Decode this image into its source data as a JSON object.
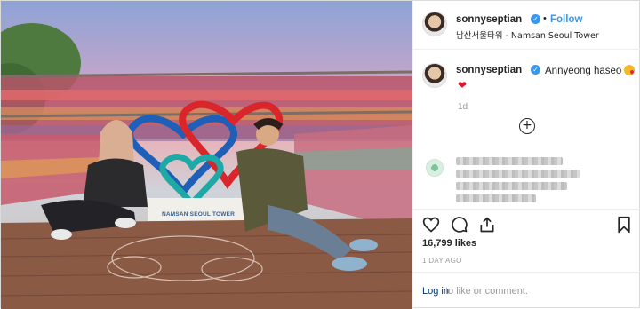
{
  "header": {
    "username": "sonnyseptian",
    "follow_label": "Follow",
    "separator": "•",
    "location": "남산서울타워 - Namsan Seoul Tower"
  },
  "photo": {
    "sign_text": "NAMSAN SEOUL TOWER"
  },
  "caption": {
    "username": "sonnyseptian",
    "text": "Annyeong haseo",
    "heart": "❤",
    "age": "1d"
  },
  "actions": {
    "likes": "16,799 likes",
    "date": "1 DAY AGO"
  },
  "login": {
    "link_label": "Log in",
    "rest_text": "to like or comment."
  },
  "icons": {
    "verified": "verified-badge-icon",
    "like": "heart-outline-icon",
    "comment": "comment-bubble-icon",
    "share": "share-icon",
    "save": "bookmark-icon",
    "more": "plus-circle-icon"
  },
  "colors": {
    "accent": "#3897f0",
    "link": "#003569",
    "muted": "#999999",
    "border": "#dbdbdb"
  }
}
